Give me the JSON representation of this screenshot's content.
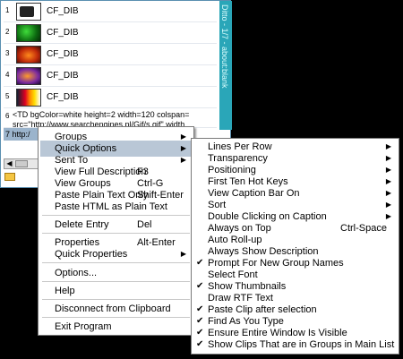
{
  "clip_window": {
    "sidebar_title": "Ditto - 1/7 - about:blank",
    "clips": [
      {
        "num": "1",
        "label": "CF_DIB"
      },
      {
        "num": "2",
        "label": "CF_DIB"
      },
      {
        "num": "3",
        "label": "CF_DIB"
      },
      {
        "num": "4",
        "label": "CF_DIB"
      },
      {
        "num": "5",
        "label": "CF_DIB"
      }
    ],
    "text_clip": {
      "num": "6",
      "line1": "<TD bgColor=white  height=2 width=120 colspan=",
      "line2": "src=\"http://www.searchengines.pl/Gif/s.gif\" width"
    },
    "selected_clip": {
      "num": "7",
      "text": "http:/"
    }
  },
  "main_menu": [
    {
      "label": "Groups",
      "shortcut": "",
      "submenu": true
    },
    {
      "label": "Quick Options",
      "shortcut": "",
      "submenu": true,
      "highlighted": true
    },
    {
      "label": "Sent To",
      "shortcut": "",
      "submenu": true
    },
    {
      "label": "View Full Description",
      "shortcut": "F3"
    },
    {
      "label": "View Groups",
      "shortcut": "Ctrl-G"
    },
    {
      "label": "Paste Plain Text Only",
      "shortcut": "Shift-Enter"
    },
    {
      "label": "Paste HTML as Plain Text",
      "shortcut": ""
    },
    {
      "label": "Delete Entry",
      "shortcut": "Del"
    },
    {
      "label": "Properties",
      "shortcut": "Alt-Enter"
    },
    {
      "label": "Quick Properties",
      "shortcut": "",
      "submenu": true
    },
    {
      "label": "Options...",
      "shortcut": ""
    },
    {
      "label": "Help",
      "shortcut": ""
    },
    {
      "label": "Disconnect from Clipboard",
      "shortcut": ""
    },
    {
      "label": "Exit Program",
      "shortcut": ""
    }
  ],
  "quick_options_menu": [
    {
      "label": "Lines Per Row",
      "submenu": true,
      "checked": false
    },
    {
      "label": "Transparency",
      "submenu": true,
      "checked": false
    },
    {
      "label": "Positioning",
      "submenu": true,
      "checked": false
    },
    {
      "label": "First Ten Hot Keys",
      "submenu": true,
      "checked": false
    },
    {
      "label": "View Caption Bar On",
      "submenu": true,
      "checked": false
    },
    {
      "label": "Sort",
      "submenu": true,
      "checked": false
    },
    {
      "label": "Double Clicking on Caption",
      "submenu": true,
      "checked": false
    },
    {
      "label": "Always on Top",
      "shortcut": "Ctrl-Space",
      "checked": false
    },
    {
      "label": "Auto Roll-up",
      "checked": false
    },
    {
      "label": "Always Show Description",
      "checked": false
    },
    {
      "label": "Prompt For New Group Names",
      "checked": true
    },
    {
      "label": "Select Font",
      "checked": false
    },
    {
      "label": "Show Thumbnails",
      "checked": true
    },
    {
      "label": "Draw RTF Text",
      "checked": false
    },
    {
      "label": "Paste Clip after selection",
      "checked": true
    },
    {
      "label": "Find As You Type",
      "checked": true
    },
    {
      "label": "Ensure Entire Window Is Visible",
      "checked": true
    },
    {
      "label": "Show Clips That are in Groups in Main List",
      "checked": true
    }
  ],
  "icons": {
    "submenu_arrow": "▶",
    "checkmark": "✔",
    "scroll_left": "◀"
  }
}
